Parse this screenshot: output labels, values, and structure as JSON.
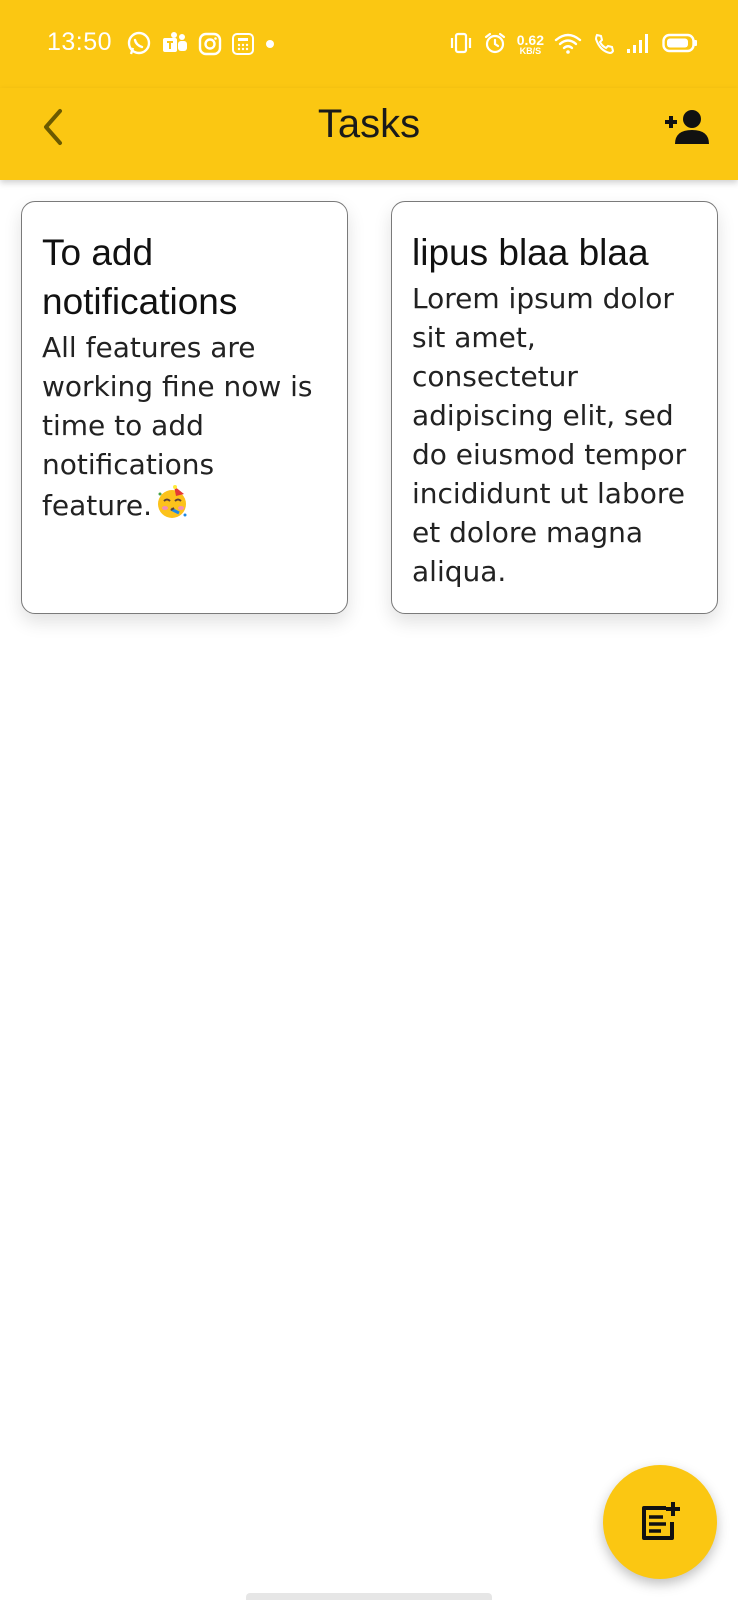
{
  "status_bar": {
    "time": "13:50",
    "net_speed_value": "0.62",
    "net_speed_unit": "KB/S",
    "left_icons": [
      "whatsapp-icon",
      "teams-icon",
      "instagram-icon",
      "calculator-icon",
      "dot-icon"
    ],
    "right_icons": [
      "vibrate-icon",
      "alarm-icon",
      "wifi-icon",
      "wifi-call-icon",
      "signal-icon",
      "battery-icon"
    ]
  },
  "app_bar": {
    "title": "Tasks",
    "back_icon": "chevron-left-icon",
    "action_icon": "person-add-icon"
  },
  "tasks": [
    {
      "title": "To add notifications",
      "body": "All features are working fine now is time to add notifications feature.",
      "emoji": "partying-face-emoji"
    },
    {
      "title": "lipus blaa blaa",
      "body": "Lorem ipsum dolor sit amet, consectetur adipiscing elit, sed do eiusmod tempor incididunt ut labore et dolore magna aliqua."
    }
  ],
  "fab": {
    "icon": "note-add-icon"
  },
  "colors": {
    "accent": "#FBC712",
    "card_border": "#7a7a7a",
    "background": "#ffffff"
  }
}
